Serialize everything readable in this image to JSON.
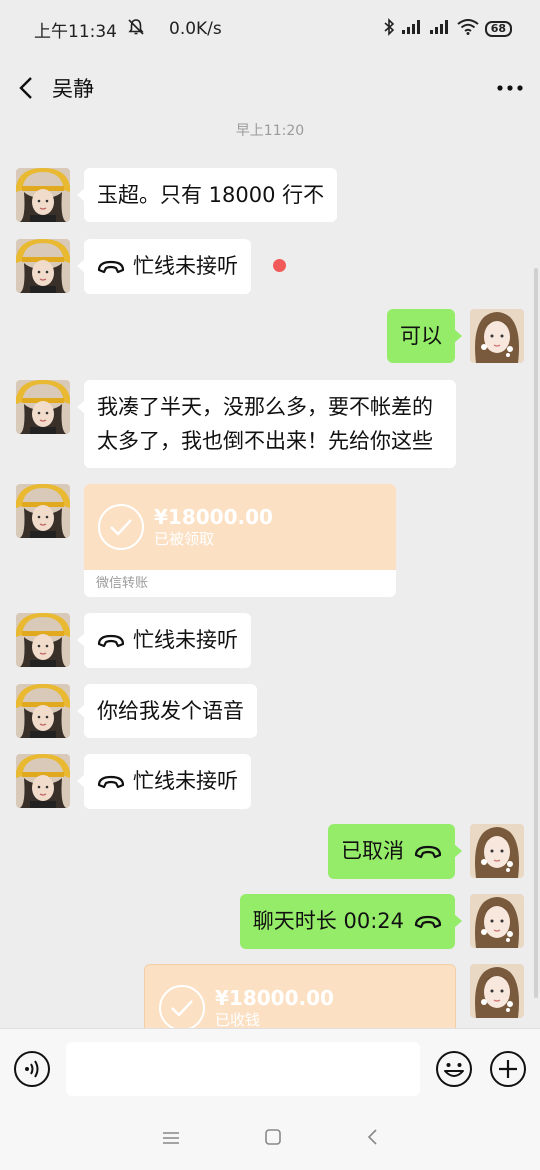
{
  "status_bar": {
    "time": "上午11:34",
    "network_speed": "0.0K/s",
    "battery": "68"
  },
  "header": {
    "title": "吴静"
  },
  "chat": {
    "timestamp": "早上11:20",
    "messages": [
      {
        "from": "contact",
        "type": "text",
        "text": "玉超。只有 18000 行不"
      },
      {
        "from": "contact",
        "type": "call",
        "text": "忙线未接听",
        "unread": true
      },
      {
        "from": "me",
        "type": "text",
        "text": "可以"
      },
      {
        "from": "contact",
        "type": "text",
        "text": "我凑了半天，没那么多，要不帐差的太多了，我也倒不出来！先给你这些"
      },
      {
        "from": "contact",
        "type": "transfer",
        "amount": "¥18000.00",
        "status": "已被领取",
        "label": "微信转账"
      },
      {
        "from": "contact",
        "type": "call",
        "text": "忙线未接听"
      },
      {
        "from": "contact",
        "type": "text",
        "text": "你给我发个语音"
      },
      {
        "from": "contact",
        "type": "call",
        "text": "忙线未接听"
      },
      {
        "from": "me",
        "type": "call",
        "text": "已取消"
      },
      {
        "from": "me",
        "type": "call",
        "text": "聊天时长 00:24"
      },
      {
        "from": "me",
        "type": "transfer",
        "amount": "¥18000.00",
        "status": "已收钱"
      }
    ]
  },
  "colors": {
    "background": "#ededed",
    "incoming_bubble": "#ffffff",
    "outgoing_bubble": "#95ec69",
    "transfer": "#fbe0c4",
    "unread_dot": "#f25a5a"
  },
  "icons": {
    "voice": "voice-input-icon",
    "emoji": "emoji-icon",
    "plus": "plus-icon",
    "call": "phone-handset-icon"
  }
}
